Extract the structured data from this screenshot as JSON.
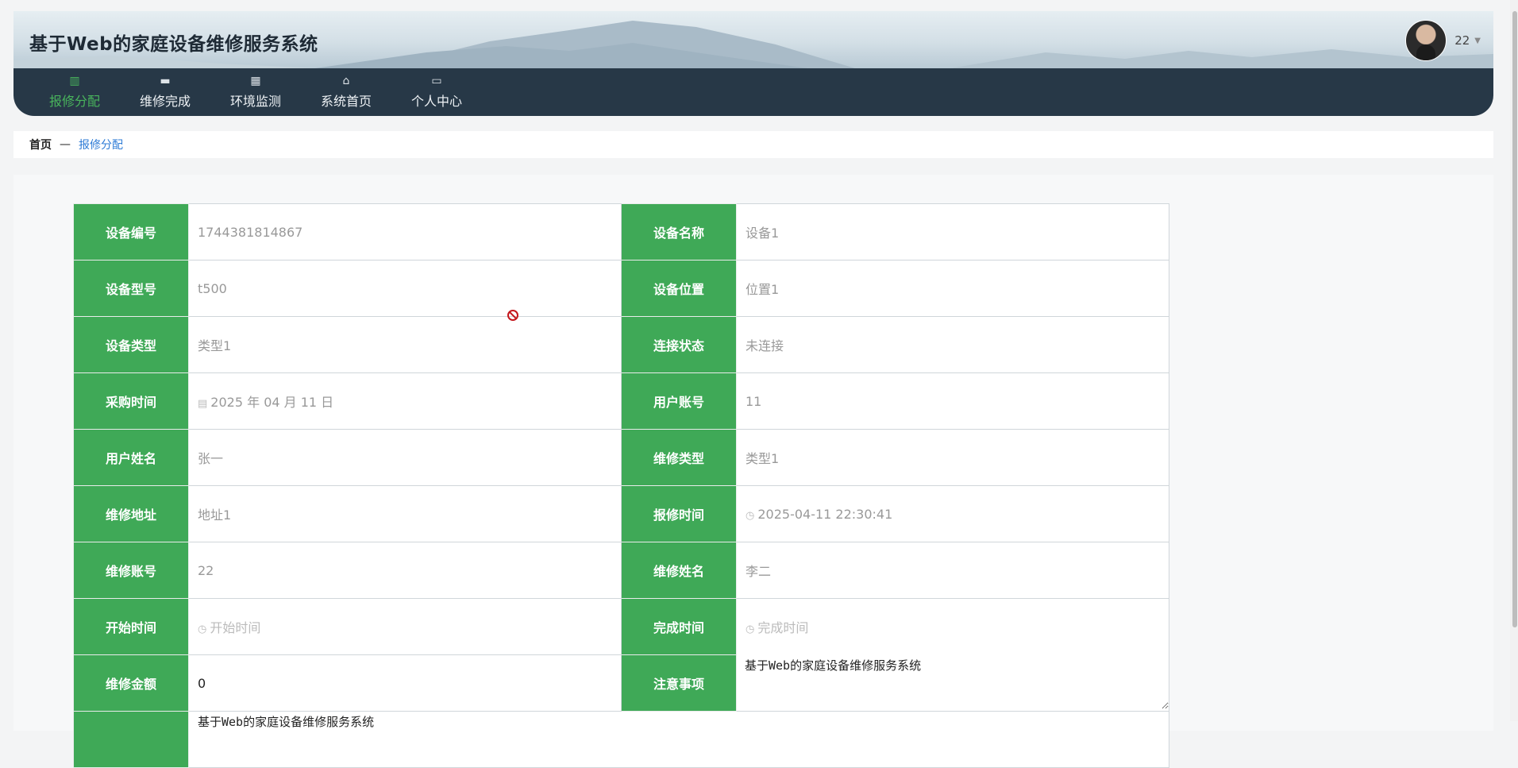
{
  "header": {
    "site_title": "基于Web的家庭设备维修服务系统",
    "user_name": "22",
    "caret": "▼"
  },
  "nav": {
    "items": [
      {
        "label": "报修分配",
        "icon": "book-icon",
        "glyph": "▥",
        "active": true
      },
      {
        "label": "维修完成",
        "icon": "briefcase-icon",
        "glyph": "▬",
        "active": false
      },
      {
        "label": "环境监测",
        "icon": "grid-icon",
        "glyph": "▦",
        "active": false
      },
      {
        "label": "系统首页",
        "icon": "home-icon",
        "glyph": "⌂",
        "active": false
      },
      {
        "label": "个人中心",
        "icon": "card-icon",
        "glyph": "▭",
        "active": false
      }
    ]
  },
  "breadcrumb": {
    "home": "首页",
    "separator": "—",
    "current": "报修分配"
  },
  "form": {
    "device_no": {
      "label": "设备编号",
      "value": "1744381814867"
    },
    "device_name": {
      "label": "设备名称",
      "value": "设备1"
    },
    "device_model": {
      "label": "设备型号",
      "value": "t500"
    },
    "device_location": {
      "label": "设备位置",
      "value": "位置1"
    },
    "device_type": {
      "label": "设备类型",
      "value": "类型1"
    },
    "connection_status": {
      "label": "连接状态",
      "value": "未连接"
    },
    "purchase_time": {
      "label": "采购时间",
      "value": "2025 年 04 月 11 日"
    },
    "user_account": {
      "label": "用户账号",
      "value": "11"
    },
    "user_name": {
      "label": "用户姓名",
      "value": "张一"
    },
    "repair_type": {
      "label": "维修类型",
      "value": "类型1"
    },
    "repair_address": {
      "label": "维修地址",
      "value": "地址1"
    },
    "report_time": {
      "label": "报修时间",
      "value": "2025-04-11 22:30:41"
    },
    "repair_account": {
      "label": "维修账号",
      "value": "22"
    },
    "repair_name": {
      "label": "维修姓名",
      "value": "李二"
    },
    "start_time": {
      "label": "开始时间",
      "placeholder": "开始时间"
    },
    "finish_time": {
      "label": "完成时间",
      "placeholder": "完成时间"
    },
    "repair_amount": {
      "label": "维修金额",
      "value": "0"
    },
    "notes": {
      "label": "注意事项",
      "value": "基于Web的家庭设备维修服务系统"
    },
    "extra": {
      "value": "基于Web的家庭设备维修服务系统"
    }
  },
  "colors": {
    "label_bg": "#3fa957",
    "nav_bg": "#273847",
    "active_nav": "#49b55c",
    "breadcrumb_link": "#2d7bd6"
  }
}
